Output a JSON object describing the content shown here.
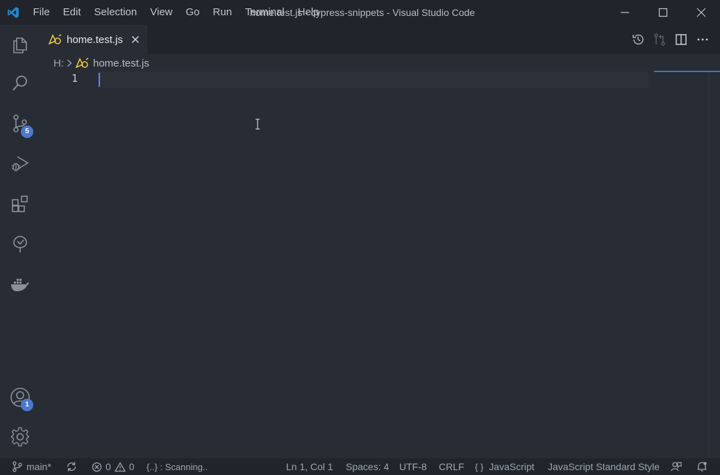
{
  "titlebar": {
    "menu": [
      "File",
      "Edit",
      "Selection",
      "View",
      "Go",
      "Run",
      "Terminal",
      "Help"
    ],
    "title": "home.test.js - cypress-snippets - Visual Studio Code"
  },
  "activity_bar": {
    "items": [
      {
        "icon": "explorer-icon"
      },
      {
        "icon": "search-icon"
      },
      {
        "icon": "source-control-icon",
        "badge": "5"
      },
      {
        "icon": "run-debug-icon"
      },
      {
        "icon": "extensions-icon"
      },
      {
        "icon": "tree-icon"
      },
      {
        "icon": "docker-icon"
      }
    ],
    "accounts_badge": "1"
  },
  "tabs": [
    {
      "label": "home.test.js",
      "icon": "cypress-file-icon",
      "active": true
    }
  ],
  "breadcrumb": {
    "drive": "H:",
    "file": "home.test.js"
  },
  "editor": {
    "line_numbers": [
      "1"
    ],
    "cursor_line": 1
  },
  "statusbar": {
    "branch": "main*",
    "errors": "0",
    "warnings": "0",
    "scanning": "{..} : Scanning..",
    "position": "Ln 1, Col 1",
    "spaces": "Spaces: 4",
    "encoding": "UTF-8",
    "eol": "CRLF",
    "language_braces": "{ }",
    "language": "JavaScript",
    "formatter": "JavaScript Standard Style"
  },
  "colors": {
    "accent": "#4d78cc",
    "cursor": "#528bff",
    "vscode_logo": "#2489ca",
    "cypress_icon": "#e8c547"
  }
}
